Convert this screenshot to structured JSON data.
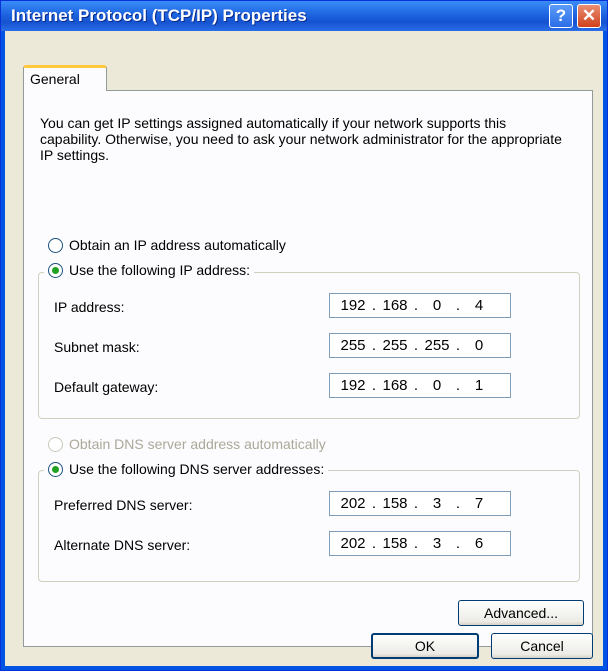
{
  "window": {
    "title": "Internet Protocol (TCP/IP) Properties",
    "help_symbol": "?",
    "close_symbol": "✕"
  },
  "tabs": [
    {
      "label": "General",
      "selected": true
    }
  ],
  "description": "You can get IP settings assigned automatically if your network supports this capability. Otherwise, you need to ask your network administrator for the appropriate IP settings.",
  "ip": {
    "auto_option": {
      "label": "Obtain an IP address automatically",
      "checked": false
    },
    "manual_option": {
      "label": "Use the following IP address:",
      "checked": true
    },
    "fields": [
      {
        "label": "IP address:",
        "octets": [
          "192",
          "168",
          "0",
          "4"
        ]
      },
      {
        "label": "Subnet mask:",
        "octets": [
          "255",
          "255",
          "255",
          "0"
        ]
      },
      {
        "label": "Default gateway:",
        "octets": [
          "192",
          "168",
          "0",
          "1"
        ]
      }
    ]
  },
  "dns": {
    "auto_option": {
      "label": "Obtain DNS server address automatically",
      "checked": false,
      "disabled": true
    },
    "manual_option": {
      "label": "Use the following DNS server addresses:",
      "checked": true
    },
    "fields": [
      {
        "label": "Preferred DNS server:",
        "octets": [
          "202",
          "158",
          "3",
          "7"
        ]
      },
      {
        "label": "Alternate DNS server:",
        "octets": [
          "202",
          "158",
          "3",
          "6"
        ]
      }
    ]
  },
  "buttons": {
    "advanced": "Advanced...",
    "ok": "OK",
    "cancel": "Cancel"
  },
  "colors": {
    "title_bar": "#1e64e0",
    "dialog_bg": "#ece9d8",
    "tab_highlight": "#ffc83c",
    "radio_dot": "#21a121",
    "close_button": "#d0411c"
  }
}
